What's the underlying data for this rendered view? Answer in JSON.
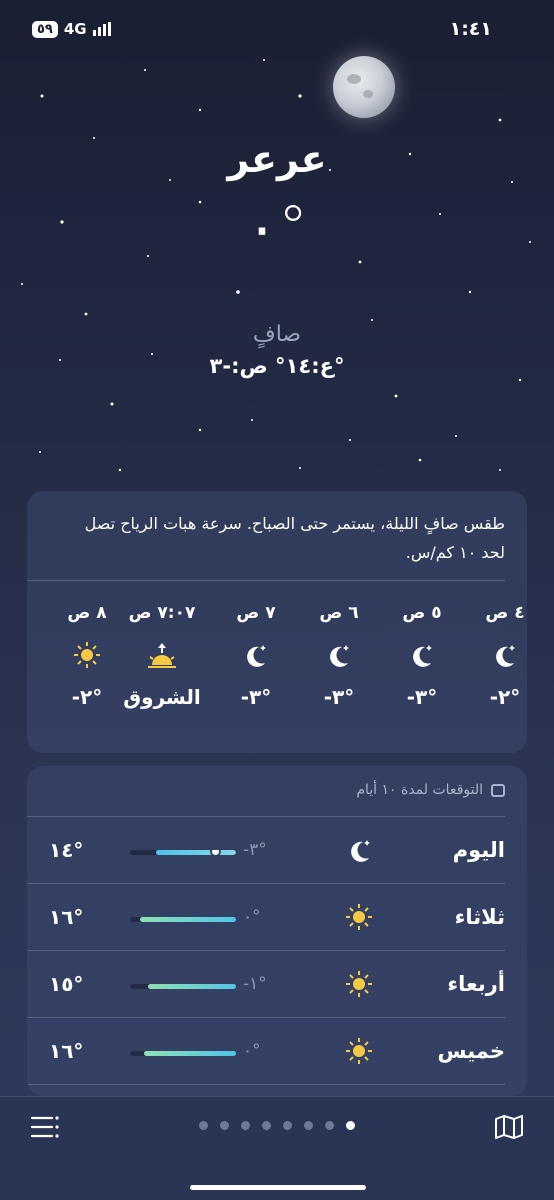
{
  "status": {
    "time": "١:٤١",
    "network": "4G",
    "battery": "٥٩"
  },
  "city": "عرعر",
  "temperature": "٠°",
  "condition": "صافٍ",
  "hilo": "ع:١٤° ص:-٣°",
  "summary": "طقس صافٍ الليلة، يستمر حتى الصباح. سرعة هبات الرياح تصل لحد ١٠ كم/س.",
  "hourly": [
    {
      "hour": "٤ ص",
      "icon": "moon-stars-icon",
      "temp": "-٢°"
    },
    {
      "hour": "٥ ص",
      "icon": "moon-stars-icon",
      "temp": "-٣°"
    },
    {
      "hour": "٦ ص",
      "icon": "moon-stars-icon",
      "temp": "-٣°"
    },
    {
      "hour": "٧ ص",
      "icon": "moon-stars-icon",
      "temp": "-٣°"
    },
    {
      "hour": "٧:٠٧ ص",
      "icon": "sunrise-icon",
      "temp": "الشروق"
    },
    {
      "hour": "٨ ص",
      "icon": "sun-icon",
      "temp": "-٢°"
    }
  ],
  "forecast": {
    "heading": "التوقعات لمدة ١٠ أيام",
    "days": [
      {
        "day": "اليوم",
        "icon": "moon-stars-icon",
        "low": "-٣°",
        "high": "١٤°",
        "current_fraction": 0.8
      },
      {
        "day": "ثلاثاء",
        "icon": "sun-icon",
        "low": "٠°",
        "high": "١٦°"
      },
      {
        "day": "أربعاء",
        "icon": "sun-icon",
        "low": "-١°",
        "high": "١٥°"
      },
      {
        "day": "خميس",
        "icon": "sun-icon",
        "low": "٠°",
        "high": "١٦°"
      }
    ]
  },
  "pager": {
    "count": 8,
    "active": 7
  },
  "colors": {
    "accent_cool": "#4ec3e9",
    "accent_warm": "#8fe0b5",
    "text_dim": "#8d97b3"
  }
}
